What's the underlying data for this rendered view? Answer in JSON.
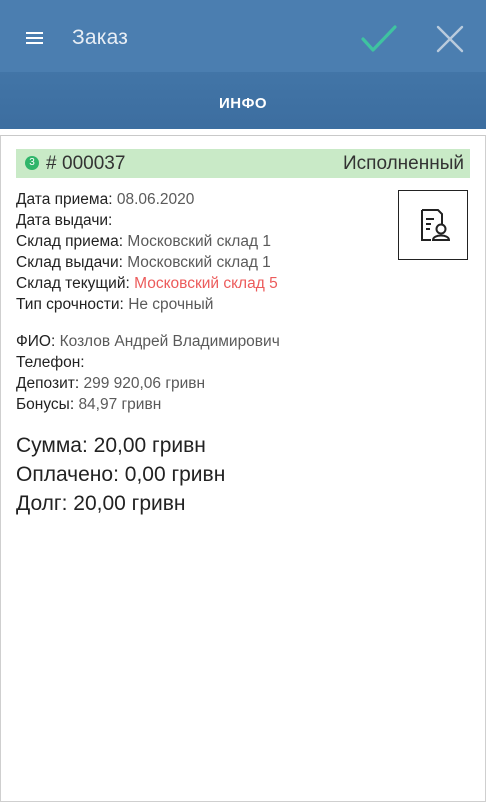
{
  "header": {
    "title": "Заказ",
    "colors": {
      "appbar": "#4b7eb0",
      "check": "#3fc3a0",
      "close": "#b9cbdd"
    }
  },
  "tabs": [
    {
      "label": "ИНФО",
      "active": true
    }
  ],
  "order": {
    "status_badge": "3",
    "hash": "#",
    "number": "000037",
    "status": "Исполненный",
    "status_color": "#c9eac7"
  },
  "details": [
    {
      "label": "Дата приема:",
      "value": "08.06.2020"
    },
    {
      "label": "Дата выдачи:",
      "value": ""
    },
    {
      "label": "Склад приема:",
      "value": "Московский склад 1"
    },
    {
      "label": "Склад выдачи:",
      "value": "Московский склад 1"
    },
    {
      "label": "Склад текущий:",
      "value": "Московский склад 5",
      "highlight": "#ec5b5b"
    },
    {
      "label": "Тип срочности:",
      "value": "Не срочный"
    }
  ],
  "customer": [
    {
      "label": "ФИО:",
      "value": "Козлов Андрей Владимирович"
    },
    {
      "label": "Телефон:",
      "value": ""
    },
    {
      "label": "Депозит:",
      "value": "299 920,06 гривн"
    },
    {
      "label": "Бонусы:",
      "value": "84,97 гривн"
    }
  ],
  "totals": [
    {
      "label": "Сумма:",
      "value": "20,00 гривн"
    },
    {
      "label": "Оплачено:",
      "value": "0,00 гривн"
    },
    {
      "label": "Долг:",
      "value": "20,00 гривн"
    }
  ],
  "icons": {
    "menu": "hamburger-menu-icon",
    "confirm": "checkmark-icon",
    "close": "close-icon",
    "document": "document-user-icon"
  }
}
